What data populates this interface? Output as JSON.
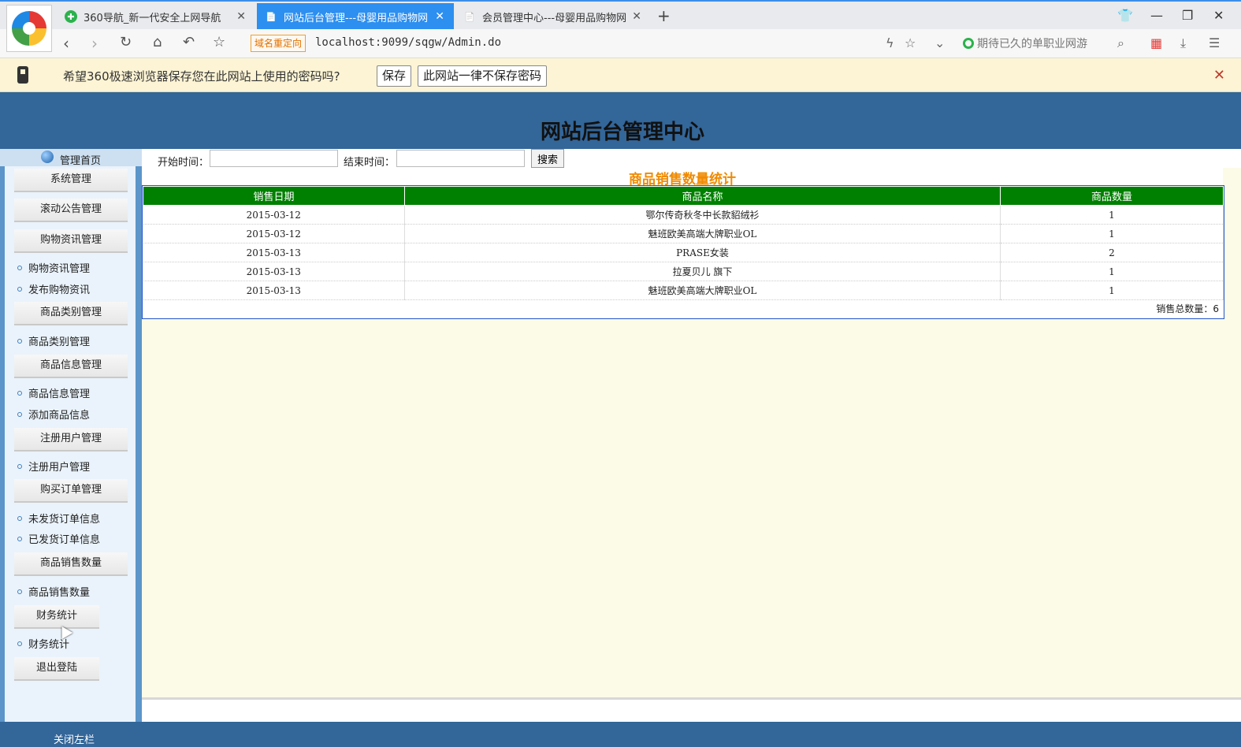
{
  "browser": {
    "tabs": [
      {
        "title": "360导航_新一代安全上网导航",
        "icon": "✚",
        "active": false
      },
      {
        "title": "网站后台管理---母婴用品购物网",
        "icon": "📄",
        "active": true
      },
      {
        "title": "会员管理中心---母婴用品购物网",
        "icon": "📄",
        "active": false
      }
    ],
    "redirect_label": "域名重定向",
    "url": "localhost:9099/sqgw/Admin.do",
    "search_hint": "期待已久的单职业网游"
  },
  "password_bar": {
    "message": "希望360极速浏览器保存您在此网站上使用的密码吗?",
    "save_label": "保存",
    "never_label": "此网站一律不保存密码"
  },
  "page": {
    "title": "网站后台管理中心",
    "home_label": "管理首页",
    "footer_label": "关闭左栏"
  },
  "sidebar": {
    "sections": [
      {
        "label": "系统管理",
        "items": []
      },
      {
        "label": "滚动公告管理",
        "items": []
      },
      {
        "label": "购物资讯管理",
        "items": [
          "购物资讯管理",
          "发布购物资讯"
        ]
      },
      {
        "label": "商品类别管理",
        "items": [
          "商品类别管理"
        ]
      },
      {
        "label": "商品信息管理",
        "items": [
          "商品信息管理",
          "添加商品信息"
        ]
      },
      {
        "label": "注册用户管理",
        "items": [
          "注册用户管理"
        ]
      },
      {
        "label": "购买订单管理",
        "items": [
          "未发货订单信息",
          "已发货订单信息"
        ]
      },
      {
        "label": "商品销售数量",
        "items": [
          "商品销售数量"
        ]
      },
      {
        "label": "财务统计",
        "items": [
          "财务统计"
        ]
      },
      {
        "label": "退出登陆",
        "items": []
      }
    ]
  },
  "filter": {
    "start_label": "开始时间：",
    "start_value": "",
    "end_label": "结束时间：",
    "end_value": "",
    "search_label": "搜索"
  },
  "report": {
    "title": "商品销售数量统计",
    "columns": [
      "销售日期",
      "商品名称",
      "商品数量"
    ],
    "rows": [
      [
        "2015-03-12",
        "鄂尔传奇秋冬中长款貂绒衫",
        "1"
      ],
      [
        "2015-03-12",
        "魅班欧美高端大牌职业OL",
        "1"
      ],
      [
        "2015-03-13",
        "PRASE女装",
        "2"
      ],
      [
        "2015-03-13",
        "拉夏贝儿 旗下",
        "1"
      ],
      [
        "2015-03-13",
        "魅班欧美高端大牌职业OL",
        "1"
      ]
    ],
    "total_label": "销售总数量：6"
  }
}
